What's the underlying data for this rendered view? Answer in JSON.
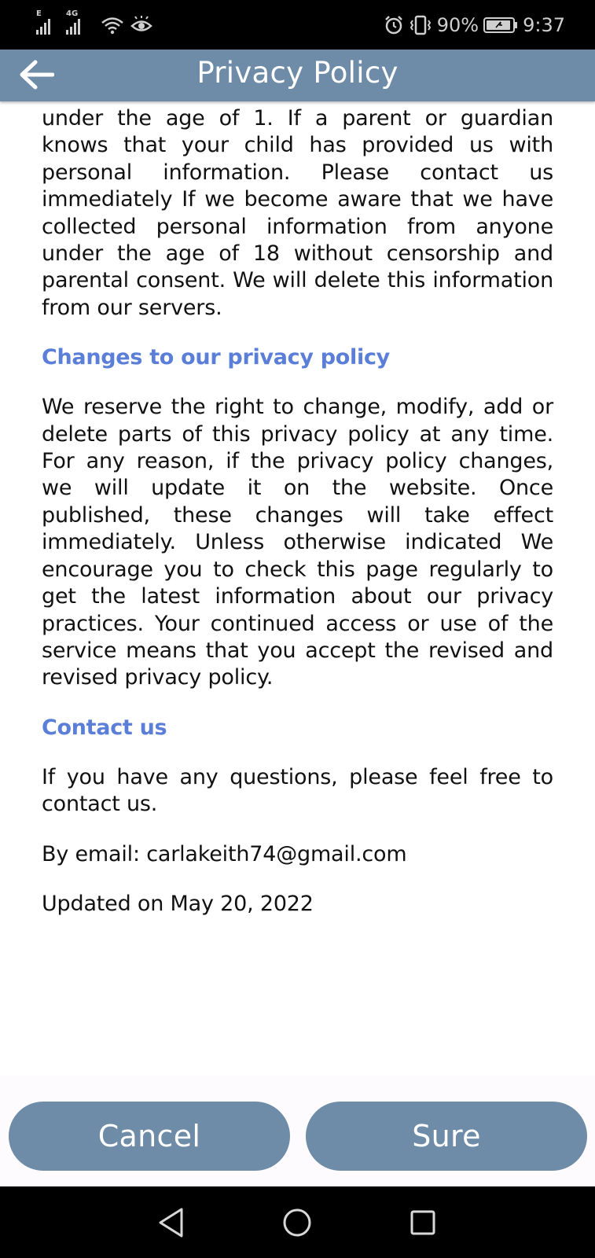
{
  "status_bar": {
    "net_1": "E",
    "net_2": "4G",
    "battery_percent": "90%",
    "time": "9:37"
  },
  "app_bar": {
    "title": "Privacy Policy"
  },
  "content": {
    "para_intro": "under the age of 1. If a parent or guardian knows that your child has provided us with personal information. Please contact us immediately If we become aware that we have collected personal information from anyone under the age of 18 without censorship and parental consent. We will delete this information from our servers.",
    "heading_changes": "Changes to our privacy policy",
    "para_changes": "We reserve the right to change, modify, add or delete parts of this privacy policy at any time. For any reason, if the privacy policy changes, we will update it on the website. Once published, these changes will take effect immediately. Unless otherwise indicated We encourage you to check this page regularly to get the latest information about our privacy practices. Your continued access or use of the service means that you accept the revised and revised privacy policy.",
    "heading_contact": "Contact us",
    "para_contact": "If you have any questions, please feel free to contact us.",
    "email_line": "By email: carlakeith74@gmail.com",
    "updated_line": "Updated on May 20, 2022"
  },
  "buttons": {
    "cancel": "Cancel",
    "sure": "Sure"
  },
  "colors": {
    "app_bar": "#6e8ca7",
    "heading": "#5b7fd8",
    "button": "#6e8ca7"
  }
}
